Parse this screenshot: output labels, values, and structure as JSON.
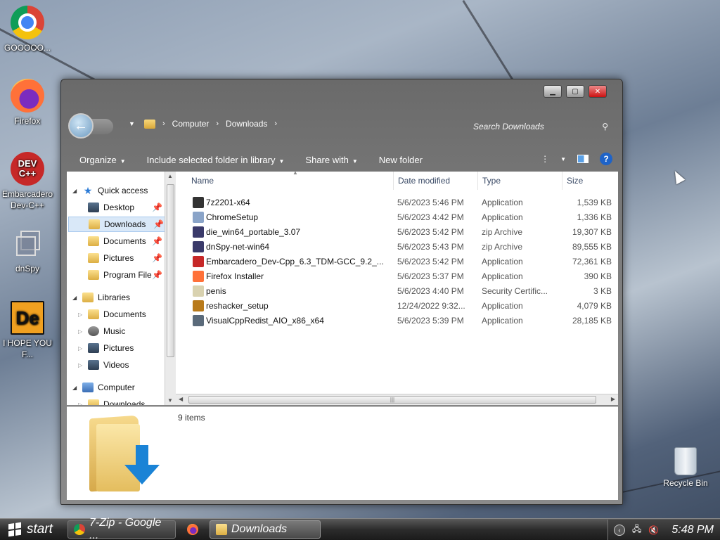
{
  "desktop": {
    "icons": [
      {
        "label": "GOOOOO..."
      },
      {
        "label": "Firefox"
      },
      {
        "label": "Embarcadero Dev-C++",
        "badge": "DEV C++"
      },
      {
        "label": "dnSpy"
      },
      {
        "label": "I HOPE YOU F...",
        "badge": "De"
      }
    ],
    "recycle_bin": "Recycle Bin"
  },
  "window": {
    "breadcrumb": [
      "Computer",
      "Downloads"
    ],
    "search_placeholder": "Search Downloads",
    "toolbar": [
      "Organize",
      "Include selected folder in library",
      "Share with",
      "New folder"
    ],
    "help": "?",
    "nav": {
      "quick_access": "Quick access",
      "quick_items": [
        "Desktop",
        "Downloads",
        "Documents",
        "Pictures",
        "Program File"
      ],
      "libraries": "Libraries",
      "library_items": [
        "Documents",
        "Music",
        "Pictures",
        "Videos"
      ],
      "computer": "Computer",
      "computer_items": [
        "Downloads"
      ]
    },
    "columns": [
      "Name",
      "Date modified",
      "Type",
      "Size"
    ],
    "files": [
      {
        "name": "7z2201-x64",
        "date": "5/6/2023 5:46 PM",
        "type": "Application",
        "size": "1,539 KB",
        "icon": "7zip-icon",
        "color": "#333333"
      },
      {
        "name": "ChromeSetup",
        "date": "5/6/2023 4:42 PM",
        "type": "Application",
        "size": "1,336 KB",
        "icon": "setup-icon",
        "color": "#8aa4c8"
      },
      {
        "name": "die_win64_portable_3.07",
        "date": "5/6/2023 5:42 PM",
        "type": "zip Archive",
        "size": "19,307 KB",
        "icon": "zip-icon",
        "color": "#3a3a6a"
      },
      {
        "name": "dnSpy-net-win64",
        "date": "5/6/2023 5:43 PM",
        "type": "zip Archive",
        "size": "89,555 KB",
        "icon": "zip-icon",
        "color": "#3a3a6a"
      },
      {
        "name": "Embarcadero_Dev-Cpp_6.3_TDM-GCC_9.2_...",
        "date": "5/6/2023 5:42 PM",
        "type": "Application",
        "size": "72,361 KB",
        "icon": "devcpp-icon",
        "color": "#c62828"
      },
      {
        "name": "Firefox Installer",
        "date": "5/6/2023 5:37 PM",
        "type": "Application",
        "size": "390 KB",
        "icon": "firefox-icon",
        "color": "#ff7139"
      },
      {
        "name": "penis",
        "date": "5/6/2023 4:40 PM",
        "type": "Security Certific...",
        "size": "3 KB",
        "icon": "certificate-icon",
        "color": "#d9d2b0"
      },
      {
        "name": "reshacker_setup",
        "date": "12/24/2022 9:32...",
        "type": "Application",
        "size": "4,079 KB",
        "icon": "reshacker-icon",
        "color": "#b87a1a"
      },
      {
        "name": "VisualCppRedist_AIO_x86_x64",
        "date": "5/6/2023 5:39 PM",
        "type": "Application",
        "size": "28,185 KB",
        "icon": "installer-icon",
        "color": "#5a6a7a"
      }
    ],
    "status": "9 items"
  },
  "taskbar": {
    "start": "start",
    "tasks": [
      "7-Zip - Google ...",
      "Downloads"
    ],
    "clock": "5:48 PM"
  }
}
